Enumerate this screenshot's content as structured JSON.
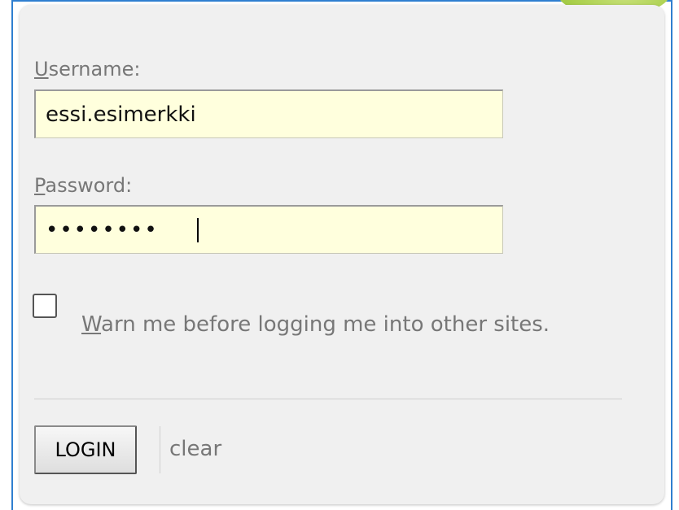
{
  "form": {
    "username": {
      "label_accel": "U",
      "label_rest": "sername:",
      "value": "essi.esimerkki"
    },
    "password": {
      "label_accel": "P",
      "label_rest": "assword:",
      "value": "••••••••"
    },
    "warn": {
      "checked": false,
      "label_accel": "W",
      "label_rest": "arn me before logging me into other sites."
    },
    "login_label": "LOGIN",
    "clear_label": "clear"
  },
  "colors": {
    "panel_background": "#f0f0f0",
    "input_background": "#ffffdd",
    "label_text": "#777777",
    "frame_accent": "#2f7fd0",
    "corner_decoration": "#a9cf4a"
  }
}
